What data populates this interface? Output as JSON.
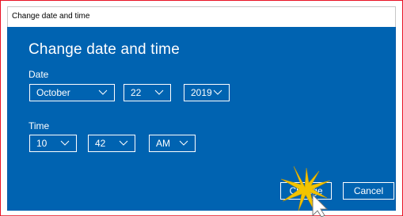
{
  "window": {
    "title": "Change date and time"
  },
  "dialog": {
    "heading": "Change date and time",
    "date_label": "Date",
    "time_label": "Time",
    "month": "October",
    "day": "22",
    "year": "2019",
    "hour": "10",
    "minute": "42",
    "ampm": "AM",
    "change_label": "Change",
    "cancel_label": "Cancel"
  },
  "colors": {
    "dialog_bg": "#0063b1",
    "frame_border": "#e81123",
    "highlight": "#f2c400"
  },
  "icons": {
    "dropdown": "chevron-down-icon",
    "cursor": "mouse-pointer-icon",
    "click": "click-highlight-icon"
  }
}
